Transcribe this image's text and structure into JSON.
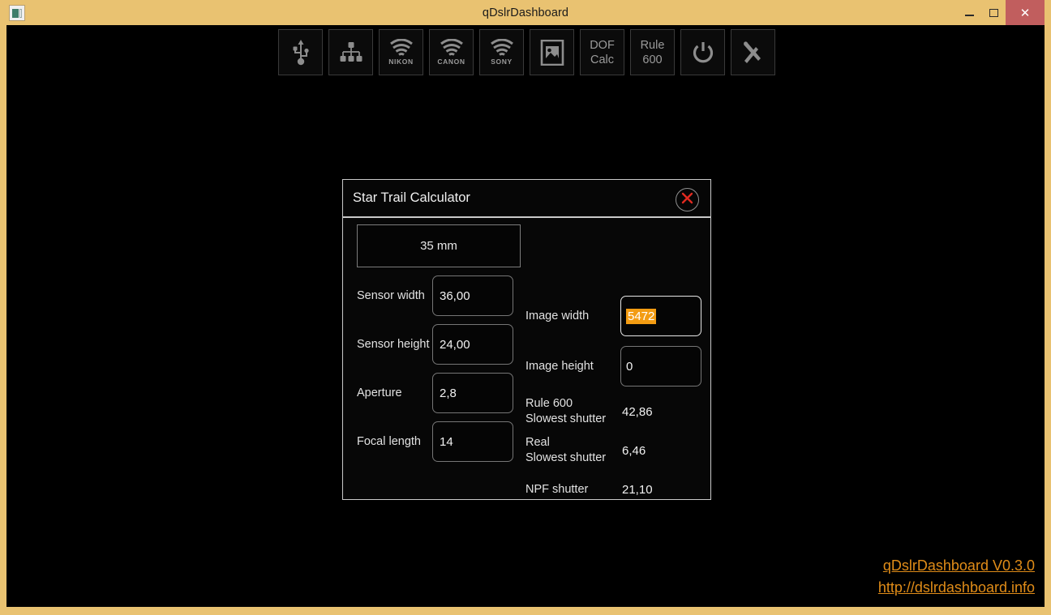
{
  "window": {
    "title": "qDslrDashboard",
    "app_icon": "app-window-icon",
    "controls": {
      "minimize": "–",
      "maximize": "□",
      "close": "✕"
    },
    "accent_color": "#e9c271",
    "close_button_color": "#c15e5e"
  },
  "toolbar": {
    "buttons": [
      {
        "name": "usb",
        "icon": "usb-icon",
        "label": ""
      },
      {
        "name": "network",
        "icon": "network-tree-icon",
        "label": ""
      },
      {
        "name": "nikon-wifi",
        "icon": "wifi-icon",
        "label": "NIKON"
      },
      {
        "name": "canon-wifi",
        "icon": "wifi-icon",
        "label": "CANON"
      },
      {
        "name": "sony-wifi",
        "icon": "wifi-icon",
        "label": "SONY"
      },
      {
        "name": "gallery",
        "icon": "image-icon",
        "label": ""
      },
      {
        "name": "dof-calc",
        "icon": "",
        "label_line1": "DOF",
        "label_line2": "Calc"
      },
      {
        "name": "rule-600",
        "icon": "",
        "label_line1": "Rule",
        "label_line2": "600"
      },
      {
        "name": "power",
        "icon": "power-icon",
        "label": ""
      },
      {
        "name": "tools",
        "icon": "tools-icon",
        "label": ""
      }
    ]
  },
  "dialog": {
    "title": "Star Trail Calculator",
    "close_icon": "close-x-icon",
    "focal_preset": "35 mm",
    "left_fields": [
      {
        "label": "Sensor width",
        "value": "36,00"
      },
      {
        "label": "Sensor height",
        "value": "24,00"
      },
      {
        "label": "Aperture",
        "value": "2,8"
      },
      {
        "label": "Focal length",
        "value": "14"
      }
    ],
    "right_inputs": [
      {
        "label": "Image width",
        "value": "5472",
        "selected": true
      },
      {
        "label": "Image height",
        "value": "0",
        "selected": false
      }
    ],
    "results": [
      {
        "label": "Rule 600\nSlowest shutter",
        "label_line1": "Rule 600",
        "label_line2": "Slowest shutter",
        "value": "42,86"
      },
      {
        "label": "Real\nSlowest shutter",
        "label_line1": "Real",
        "label_line2": "Slowest shutter",
        "value": "6,46"
      },
      {
        "label": "NPF shutter",
        "label_line1": "NPF shutter",
        "label_line2": "",
        "value": "21,10"
      }
    ],
    "selection_color": "#f39c12"
  },
  "footer": {
    "version_link": "qDslrDashboard V0.3.0",
    "website_link": "http://dslrdashboard.info",
    "link_color": "#e08c18"
  }
}
